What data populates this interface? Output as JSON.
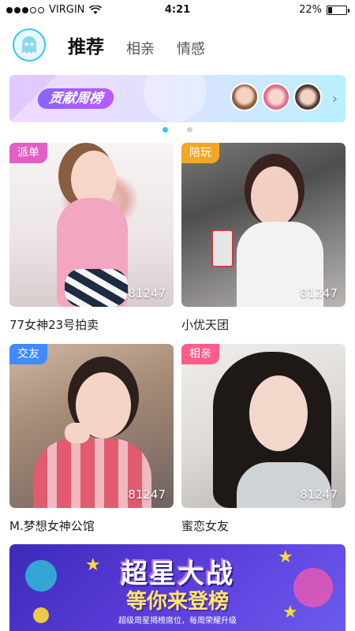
{
  "status_bar": {
    "carrier": "VIRGIN",
    "time": "4:21",
    "battery": "22%"
  },
  "tabs": [
    {
      "label": "推荐",
      "active": true
    },
    {
      "label": "相亲",
      "active": false
    },
    {
      "label": "情感",
      "active": false
    }
  ],
  "banner": {
    "title": "贡献周榜"
  },
  "cards": [
    {
      "tag": "派单",
      "count": "81247",
      "name": "77女神23号拍卖",
      "tag_color": "#e45fc5"
    },
    {
      "tag": "陪玩",
      "count": "81247",
      "name": "小优天团",
      "tag_color": "#f5a623"
    },
    {
      "tag": "交友",
      "count": "81247",
      "name": "M.梦想女神公馆",
      "tag_color": "#3f8bff"
    },
    {
      "tag": "相亲",
      "count": "81247",
      "name": "蜜恋女友",
      "tag_color": "#ff5c8a"
    }
  ],
  "bottom_banner": {
    "title": "超星大战",
    "subtitle": "等你来登榜",
    "note": "超级周星揭榜席位，每周荣耀升级"
  },
  "colors": {
    "accent": "#37c6ea"
  }
}
